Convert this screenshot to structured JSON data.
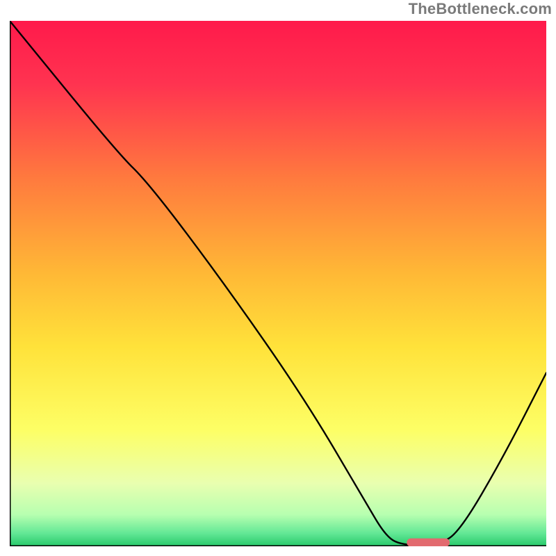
{
  "watermark": "TheBottleneck.com",
  "chart_data": {
    "type": "line",
    "title": "",
    "xlabel": "",
    "ylabel": "",
    "xlim": [
      0,
      100
    ],
    "ylim": [
      0,
      100
    ],
    "background_gradient": {
      "stops": [
        {
          "offset": 0.0,
          "color": "#ff1a4b"
        },
        {
          "offset": 0.12,
          "color": "#ff3350"
        },
        {
          "offset": 0.3,
          "color": "#ff7a3e"
        },
        {
          "offset": 0.48,
          "color": "#ffb836"
        },
        {
          "offset": 0.62,
          "color": "#ffe23a"
        },
        {
          "offset": 0.78,
          "color": "#fdff66"
        },
        {
          "offset": 0.88,
          "color": "#e9ffb0"
        },
        {
          "offset": 0.94,
          "color": "#b7ffb0"
        },
        {
          "offset": 0.975,
          "color": "#63e896"
        },
        {
          "offset": 1.0,
          "color": "#27c86a"
        }
      ]
    },
    "series": [
      {
        "name": "bottleneck-curve",
        "color": "#000000",
        "points": [
          {
            "x": 0.0,
            "y": 100.0
          },
          {
            "x": 20.0,
            "y": 75.0
          },
          {
            "x": 26.0,
            "y": 69.0
          },
          {
            "x": 40.0,
            "y": 50.0
          },
          {
            "x": 55.0,
            "y": 28.0
          },
          {
            "x": 66.0,
            "y": 9.0
          },
          {
            "x": 70.0,
            "y": 2.0
          },
          {
            "x": 73.0,
            "y": 0.2
          },
          {
            "x": 80.0,
            "y": 0.2
          },
          {
            "x": 84.0,
            "y": 3.0
          },
          {
            "x": 92.0,
            "y": 17.0
          },
          {
            "x": 100.0,
            "y": 33.0
          }
        ]
      }
    ],
    "marker": {
      "name": "optimal-range",
      "color": "#e26a6f",
      "x_start": 74.0,
      "x_end": 82.0,
      "y": 0.7,
      "thickness": 1.6
    },
    "axes": {
      "color": "#000000",
      "left": true,
      "bottom": true,
      "ticks": []
    }
  }
}
